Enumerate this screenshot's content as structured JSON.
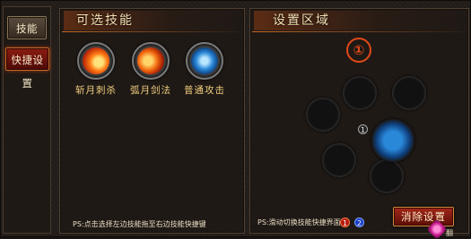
{
  "tabs": {
    "skills_label": "技能",
    "shortcut_label": "快捷设置"
  },
  "left_panel": {
    "title": "可选技能",
    "skills": [
      {
        "name": "斩月刺杀",
        "icon": "fire-slash-icon"
      },
      {
        "name": "弧月剑法",
        "icon": "crescent-moon-icon"
      },
      {
        "name": "普通攻击",
        "icon": "sword-icon"
      }
    ],
    "ps": "PS:点击选择左边技能拖至右边技能快捷键"
  },
  "right_panel": {
    "title": "设置区域",
    "marker": "①",
    "slot_badge": "1",
    "ps": "PS:滑动切换技能快捷界面",
    "page1": "1",
    "page2": "2",
    "clear_label": "消除设置",
    "flip_label": "翻"
  },
  "colors": {
    "accent": "#c46a26",
    "marker": "#e04a18",
    "skill_label": "#f0cf7e"
  }
}
